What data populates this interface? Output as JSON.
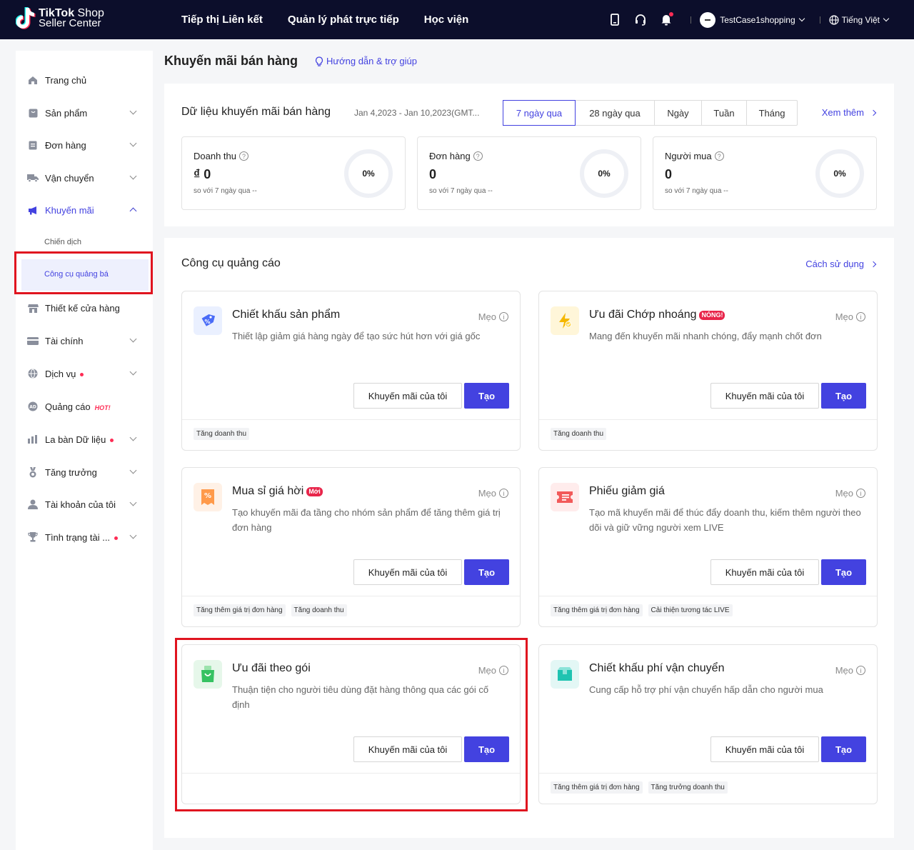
{
  "header": {
    "logo_brand": "TikTok",
    "logo_shop": "Shop",
    "logo_sub": "Seller Center",
    "nav": [
      "Tiếp thị Liên kết",
      "Quản lý phát trực tiếp",
      "Học viện"
    ],
    "username": "TestCase1shopping",
    "language": "Tiếng Việt"
  },
  "sidebar": {
    "items": [
      {
        "label": "Trang chủ",
        "icon": "home-icon"
      },
      {
        "label": "Sản phẩm",
        "icon": "product-icon"
      },
      {
        "label": "Đơn hàng",
        "icon": "order-icon"
      },
      {
        "label": "Vận chuyển",
        "icon": "truck-icon"
      },
      {
        "label": "Khuyến mãi",
        "icon": "megaphone-icon"
      },
      {
        "label": "Thiết kế cửa hàng",
        "icon": "store-icon"
      },
      {
        "label": "Tài chính",
        "icon": "card-icon"
      },
      {
        "label": "Dịch vụ",
        "icon": "globe-icon"
      },
      {
        "label": "Quảng cáo",
        "icon": "ad-icon",
        "badge": "HOT!"
      },
      {
        "label": "La bàn Dữ liệu",
        "icon": "chart-icon"
      },
      {
        "label": "Tăng trưởng",
        "icon": "medal-icon"
      },
      {
        "label": "Tài khoản của tôi",
        "icon": "user-icon"
      },
      {
        "label": "Tình trạng tài ...",
        "icon": "trophy-icon"
      }
    ],
    "sub_items": [
      "Chiến dịch",
      "Công cụ quảng bá"
    ]
  },
  "page": {
    "title": "Khuyến mãi bán hàng",
    "help": "Hướng dẫn & trợ giúp"
  },
  "data_panel": {
    "title": "Dữ liệu khuyến mãi bán hàng",
    "date_range": "Jan 4,2023 - Jan 10,2023(GMT...",
    "periods": [
      "7 ngày qua",
      "28 ngày qua",
      "Ngày",
      "Tuần",
      "Tháng"
    ],
    "selected_period": "7 ngày qua",
    "more": "Xem thêm",
    "stats": [
      {
        "label": "Doanh thu",
        "value": "₫ 0",
        "compare": "so với 7 ngày qua --",
        "percent": "0%"
      },
      {
        "label": "Đơn hàng",
        "value": "0",
        "compare": "so với 7 ngày qua --",
        "percent": "0%"
      },
      {
        "label": "Người mua",
        "value": "0",
        "compare": "so với 7 ngày qua --",
        "percent": "0%"
      }
    ]
  },
  "tools_panel": {
    "title": "Công cụ quảng cáo",
    "howto": "Cách sử dụng",
    "tip_label": "Mẹo",
    "btn_mine": "Khuyến mãi của tôi",
    "btn_create": "Tạo",
    "cards": [
      {
        "title": "Chiết khấu sản phẩm",
        "badge": "",
        "desc": "Thiết lập giảm giá hàng ngày để tạo sức hút hơn với giá gốc",
        "tags": [
          "Tăng doanh thu"
        ]
      },
      {
        "title": "Ưu đãi Chớp nhoáng",
        "badge": "NÓNG!",
        "desc": "Mang đến khuyến mãi nhanh chóng, đẩy mạnh chốt đơn",
        "tags": [
          "Tăng doanh thu"
        ]
      },
      {
        "title": "Mua sỉ giá hời",
        "badge": "Mới",
        "desc": "Tạo khuyến mãi đa tầng cho nhóm sản phẩm để tăng thêm giá trị đơn hàng",
        "tags": [
          "Tăng thêm giá trị đơn hàng",
          "Tăng doanh thu"
        ]
      },
      {
        "title": "Phiếu giảm giá",
        "badge": "",
        "desc": "Tạo mã khuyến mãi để thúc đẩy doanh thu, kiếm thêm người theo dõi và giữ vững người xem LIVE",
        "tags": [
          "Tăng thêm giá trị đơn hàng",
          "Cải thiện tương tác LIVE"
        ]
      },
      {
        "title": "Ưu đãi theo gói",
        "badge": "",
        "desc": "Thuận tiện cho người tiêu dùng đặt hàng thông qua các gói cố định",
        "tags": []
      },
      {
        "title": "Chiết khấu phí vận chuyển",
        "badge": "",
        "desc": "Cung cấp hỗ trợ phí vận chuyển hấp dẫn cho người mua",
        "tags": [
          "Tăng thêm giá trị đơn hàng",
          "Tăng trưởng doanh thu"
        ]
      }
    ]
  },
  "colors": {
    "accent": "#4342e0",
    "topbar": "#0c0e2b",
    "highlight": "#e0141f"
  }
}
